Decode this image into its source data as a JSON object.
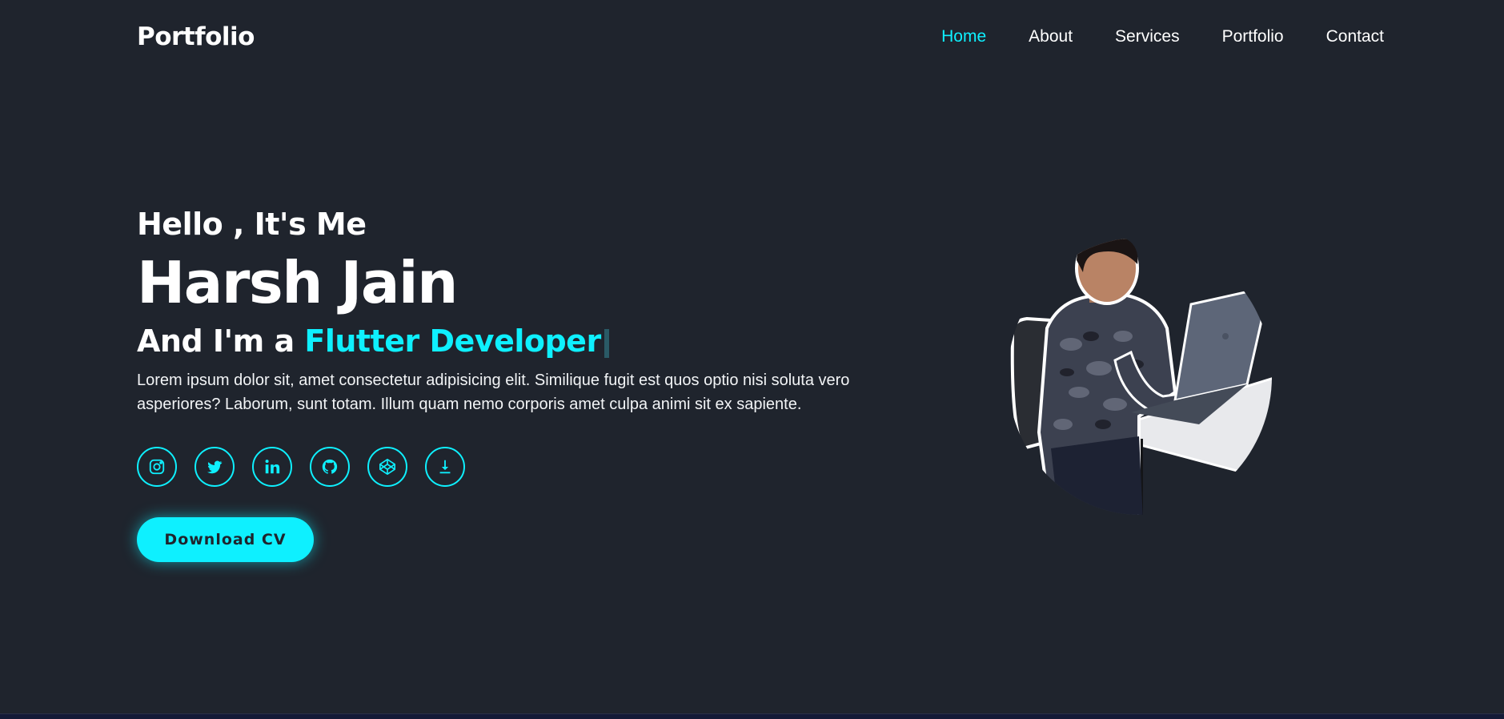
{
  "header": {
    "logo": "Portfolio",
    "nav": [
      {
        "label": "Home",
        "active": true
      },
      {
        "label": "About"
      },
      {
        "label": "Services"
      },
      {
        "label": "Portfolio"
      },
      {
        "label": "Contact"
      }
    ]
  },
  "hero": {
    "greeting": "Hello , It's Me",
    "name": "Harsh Jain",
    "role_prefix": "And I'm a",
    "role_highlight": "Flutter Developer",
    "description": "Lorem ipsum dolor sit, amet consectetur adipisicing elit. Similique fugit est quos optio nisi soluta vero asperiores? Laborum, sunt totam. Illum quam nemo corporis amet culpa animi sit ex sapiente.",
    "socials": [
      "instagram-icon",
      "twitter-icon",
      "linkedin-icon",
      "github-icon",
      "codepen-icon",
      "download-icon"
    ],
    "cta_label": "Download CV"
  },
  "colors": {
    "background": "#1f242d",
    "accent": "#0ef0ff",
    "text": "#ffffff"
  }
}
